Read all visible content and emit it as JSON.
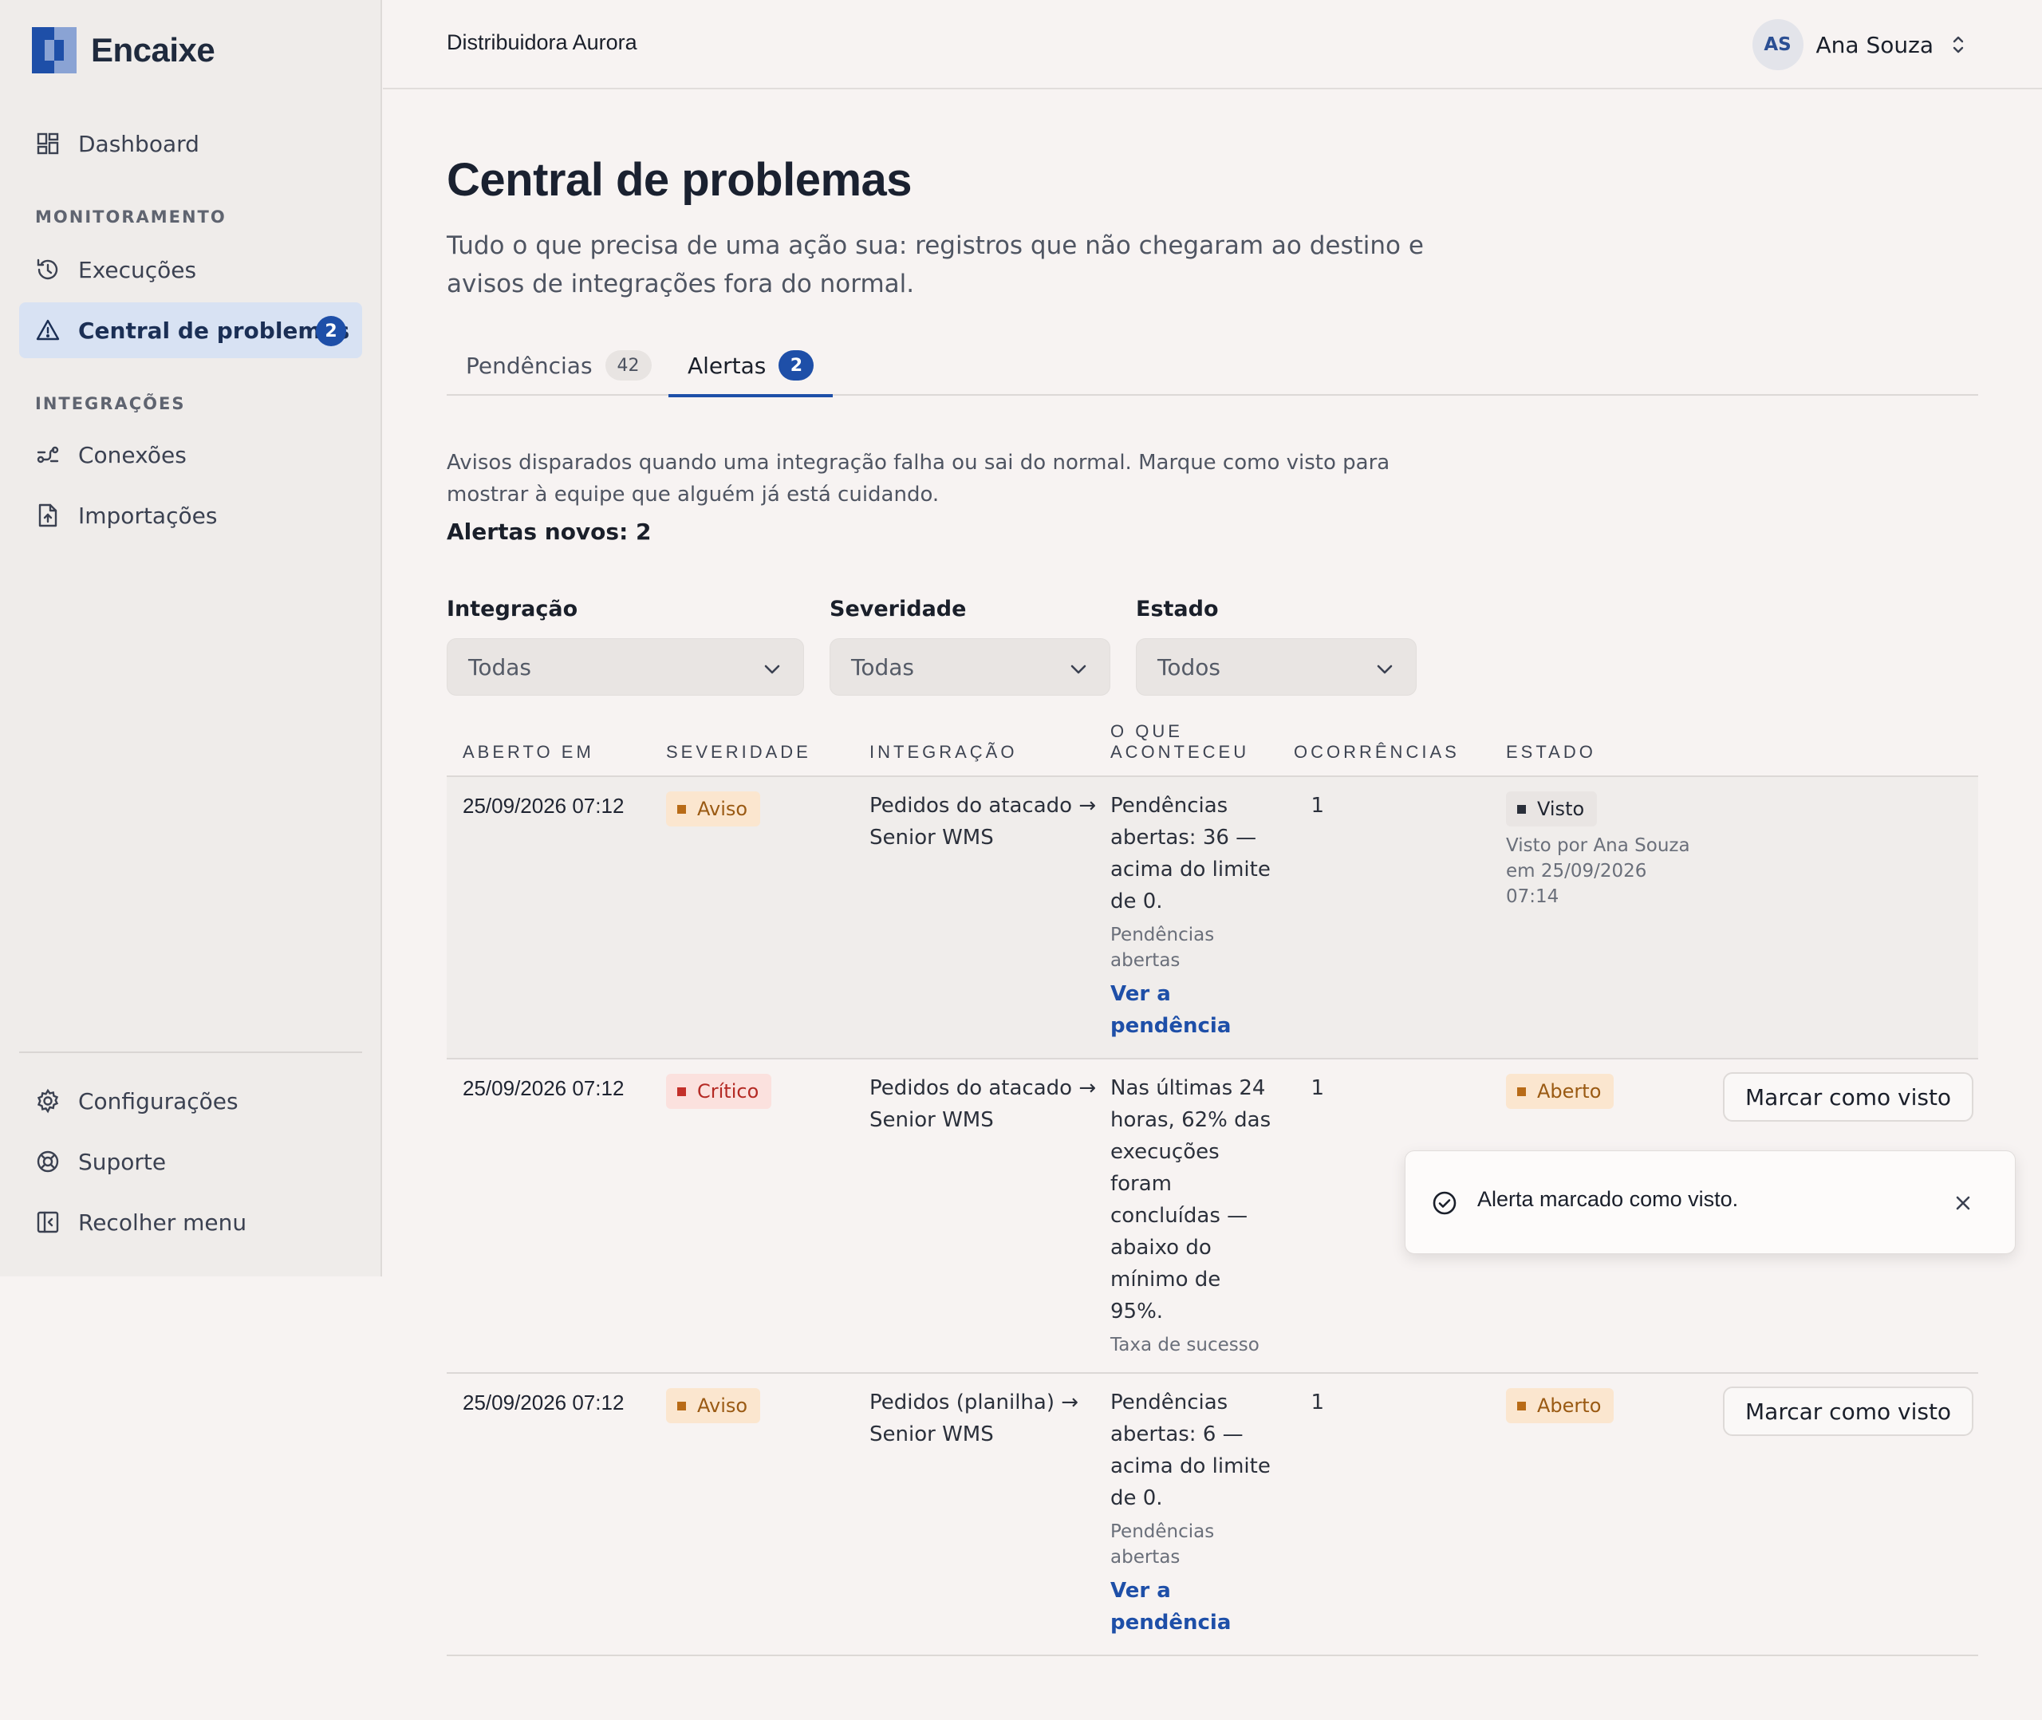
{
  "app": {
    "name": "Encaixe"
  },
  "sidebar": {
    "dashboard": "Dashboard",
    "section_monitoring": "MONITORAMENTO",
    "executions": "Execuções",
    "problems": "Central de problemas",
    "problems_badge": "2",
    "section_integrations": "INTEGRAÇÕES",
    "connections": "Conexões",
    "imports": "Importações",
    "settings": "Configurações",
    "support": "Suporte",
    "collapse": "Recolher menu"
  },
  "topbar": {
    "org": "Distribuidora Aurora",
    "avatar_initials": "AS",
    "user_name": "Ana Souza"
  },
  "page": {
    "title": "Central de problemas",
    "subtitle": "Tudo o que precisa de uma ação sua: registros que não chegaram ao destino e avisos de integrações fora do normal."
  },
  "tabs": [
    {
      "label": "Pendências",
      "count": "42"
    },
    {
      "label": "Alertas",
      "count": "2"
    }
  ],
  "alerts": {
    "intro": "Avisos disparados quando uma integração falha ou sai do normal. Marque como visto para mostrar à equipe que alguém já está cuidando.",
    "new_count_text": "Alertas novos: 2"
  },
  "filters": {
    "integration": {
      "label": "Integração",
      "value": "Todas"
    },
    "severity": {
      "label": "Severidade",
      "value": "Todas"
    },
    "state": {
      "label": "Estado",
      "value": "Todos"
    }
  },
  "table": {
    "headers": {
      "opened": "ABERTO EM",
      "severity": "SEVERIDADE",
      "integration": "INTEGRAÇÃO",
      "what_1": "O QUE",
      "what_2": "ACONTECEU",
      "occurrences": "OCORRÊNCIAS",
      "state": "ESTADO"
    },
    "rows": [
      {
        "opened": "25/09/2026 07:12",
        "severity": "Aviso",
        "integration_1": "Pedidos do atacado →",
        "integration_2": "Senior WMS",
        "what": [
          "Pendências",
          "abertas: 36 —",
          "acima do limite",
          "de 0."
        ],
        "metric": [
          "Pendências",
          "abertas"
        ],
        "link": [
          "Ver a",
          "pendência"
        ],
        "occurrences": "1",
        "state": "Visto",
        "seen_by": [
          "Visto por Ana Souza",
          "em 25/09/2026",
          "07:14"
        ]
      },
      {
        "opened": "25/09/2026 07:12",
        "severity": "Crítico",
        "integration_1": "Pedidos do atacado →",
        "integration_2": "Senior WMS",
        "what": [
          "Nas últimas 24",
          "horas, 62% das",
          "execuções",
          "foram",
          "concluídas —",
          "abaixo do",
          "mínimo de",
          "95%."
        ],
        "metric": [
          "Taxa de sucesso"
        ],
        "occurrences": "1",
        "state": "Aberto",
        "action": "Marcar como visto"
      },
      {
        "opened": "25/09/2026 07:12",
        "severity": "Aviso",
        "integration_1": "Pedidos (planilha) →",
        "integration_2": "Senior WMS",
        "what": [
          "Pendências",
          "abertas: 6 —",
          "acima do limite",
          "de 0."
        ],
        "metric": [
          "Pendências",
          "abertas"
        ],
        "link": [
          "Ver a",
          "pendência"
        ],
        "occurrences": "1",
        "state": "Aberto",
        "action": "Marcar como visto"
      }
    ]
  },
  "toast": {
    "message": "Alerta marcado como visto."
  },
  "colors": {
    "accent": "#1e4fa8",
    "warning_bg": "#fbe6cf",
    "critical_bg": "#fbe1de",
    "sidebar_active": "#d8e2f3"
  }
}
